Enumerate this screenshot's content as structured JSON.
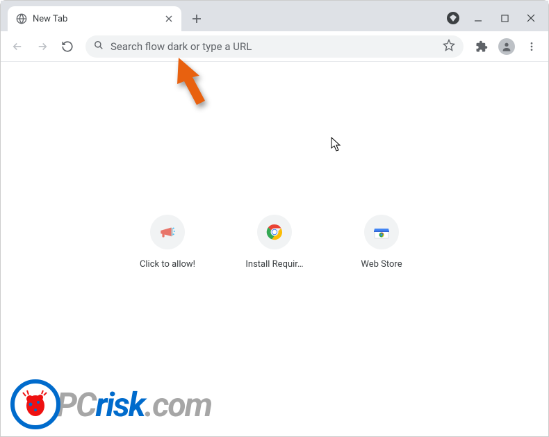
{
  "tab": {
    "title": "New Tab"
  },
  "omnibox": {
    "placeholder": "Search flow dark or type a URL",
    "value": ""
  },
  "shortcuts": [
    {
      "label": "Click to allow!"
    },
    {
      "label": "Install Requir…"
    },
    {
      "label": "Web Store"
    }
  ],
  "watermark": {
    "pc": "PC",
    "risk": "risk",
    "tld": ".com"
  }
}
